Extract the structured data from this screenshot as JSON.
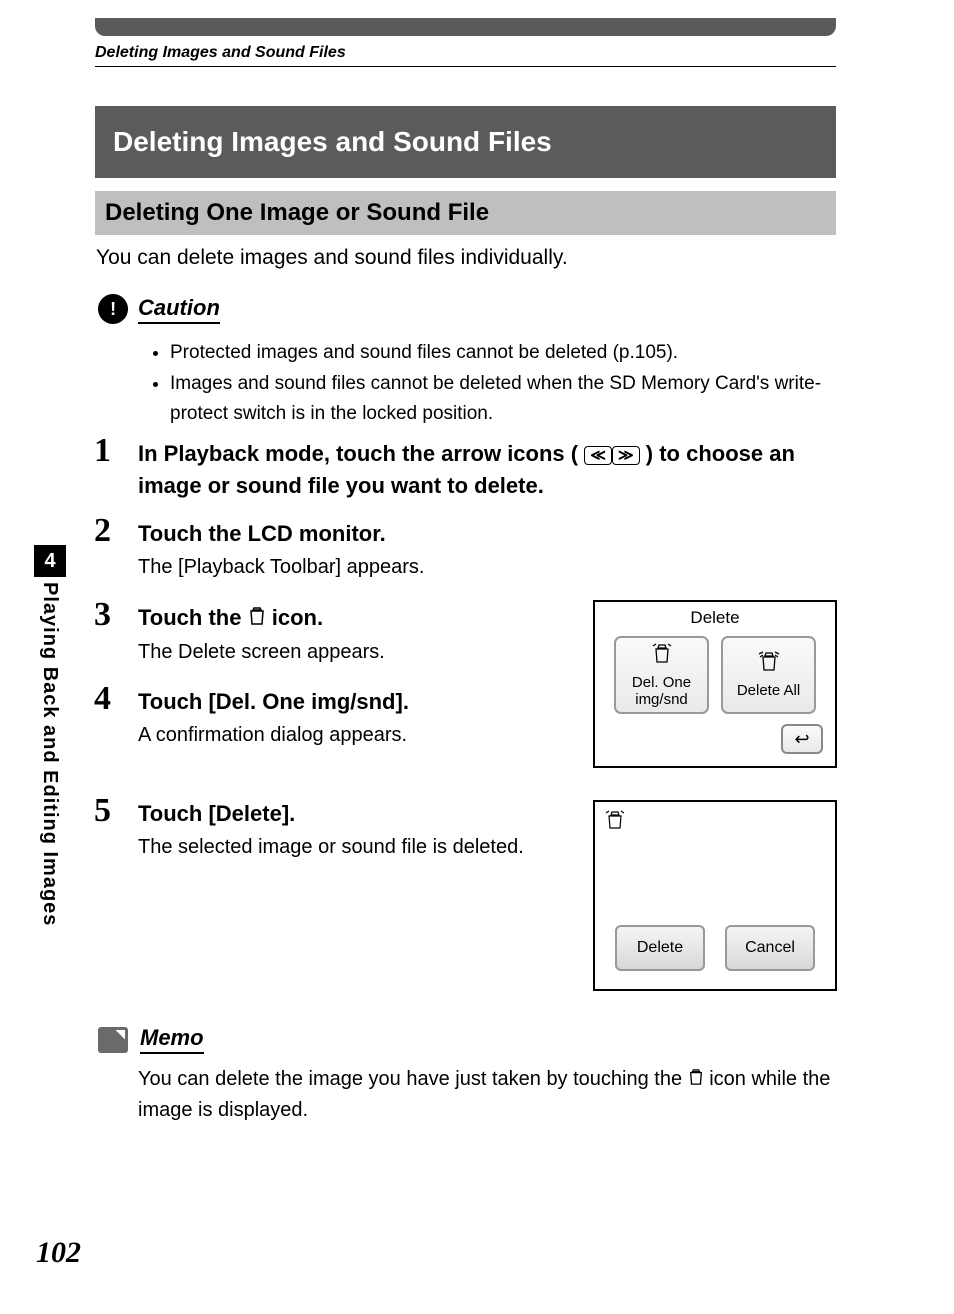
{
  "page": {
    "running_header": "Deleting Images and Sound Files",
    "number": "102",
    "side_tab_number": "4",
    "side_tab_text": "Playing Back and Editing Images"
  },
  "title": "Deleting Images and Sound Files",
  "subtitle": "Deleting One Image or Sound File",
  "intro": "You can delete images and sound files individually.",
  "caution": {
    "label": "Caution",
    "bullets": [
      "Protected images and sound files cannot be deleted (p.105).",
      "Images and sound files cannot be deleted when the SD Memory Card's write-protect switch is in the locked position."
    ]
  },
  "steps": {
    "s1": {
      "num": "1",
      "head_a": "In Playback mode, touch the arrow icons (",
      "head_b": ") to choose an image or sound file you want to delete."
    },
    "s2": {
      "num": "2",
      "head": "Touch the LCD monitor.",
      "body": "The [Playback Toolbar] appears."
    },
    "s3": {
      "num": "3",
      "head_a": "Touch the ",
      "head_b": " icon.",
      "body": "The Delete screen appears."
    },
    "s4": {
      "num": "4",
      "head": "Touch [Del. One img/snd].",
      "body": "A confirmation dialog appears."
    },
    "s5": {
      "num": "5",
      "head": "Touch [Delete].",
      "body": "The selected image or sound file is deleted."
    }
  },
  "screen1": {
    "title": "Delete",
    "btn1_l1": "Del. One",
    "btn1_l2": "img/snd",
    "btn2": "Delete All"
  },
  "screen2": {
    "delete": "Delete",
    "cancel": "Cancel"
  },
  "memo": {
    "label": "Memo",
    "text_a": "You can delete the image you have just taken by touching the ",
    "text_b": " icon while the image is displayed."
  }
}
